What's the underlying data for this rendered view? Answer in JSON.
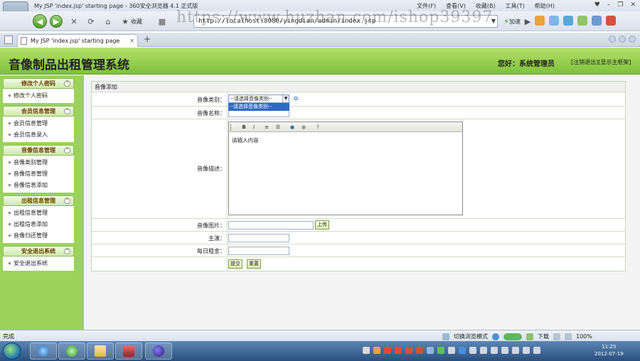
{
  "browser": {
    "window_title": "My JSP 'index.jsp' starting page - 360安全浏览器 4.1 正式版",
    "menus": [
      "文件(F)",
      "查看(V)",
      "收藏(B)",
      "工具(T)",
      "帮助(H)"
    ],
    "toolbar": {
      "favorite_label": "收藏",
      "accelerate_label": "加速"
    },
    "address_url": "http://localhost:8080/yingdian/admin/index.jsp",
    "watermark": "https://www.huzhan.com/ishop39397",
    "tab_title": "My JSP 'index.jsp' starting page",
    "status_text": "完成",
    "status_right": {
      "mode_label": "切换浏览模式",
      "download_label": "下载",
      "zoom": "100%"
    }
  },
  "app": {
    "title": "音像制品出租管理系统",
    "greeting": "您好：系统管理员",
    "logout_link": "[注销退出]",
    "home_link": "[显示主框架]"
  },
  "sidebar": {
    "groups": [
      {
        "title": "修改个人密码",
        "items": [
          "修改个人密码"
        ]
      },
      {
        "title": "会员信息管理",
        "items": [
          "会员信息管理",
          "会员信息录入"
        ]
      },
      {
        "title": "音像信息管理",
        "items": [
          "音像类别管理",
          "音像信息管理",
          "音像信息添加"
        ]
      },
      {
        "title": "出租信息管理",
        "items": [
          "出租信息管理",
          "出租信息添加",
          "音像归还管理"
        ]
      },
      {
        "title": "安全退出系统",
        "items": [
          "安全退出系统"
        ]
      }
    ]
  },
  "form": {
    "panel_title": "音像添加",
    "category_label": "音像类别：",
    "category_value": "--请选择音像类别--",
    "category_option": "--请选择音像类别--",
    "name_label": "音像名称：",
    "desc_label": "音像描述：",
    "editor_placeholder": "请输入内容",
    "image_label": "音像图片：",
    "upload_button": "上传",
    "actor_label": "主演：",
    "rent_label": "每日租金：",
    "submit_button": "提交",
    "reset_button": "重置"
  },
  "taskbar": {
    "time": "11:25",
    "date": "2012-07-19"
  },
  "colors": {
    "header_green": "#7ec13a",
    "sidebar_green": "#9ad25c",
    "select_highlight": "#3169c6"
  }
}
